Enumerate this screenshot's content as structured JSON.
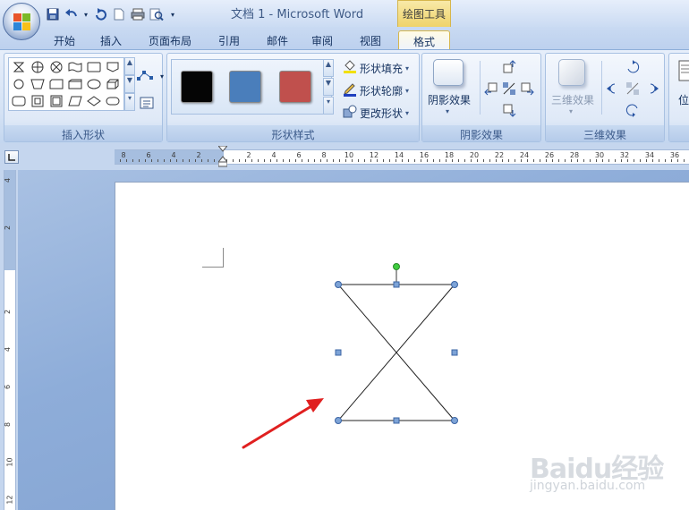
{
  "window": {
    "title": "文档 1 - Microsoft Word",
    "context_tab_group": "绘图工具"
  },
  "tabs": [
    {
      "label": "开始"
    },
    {
      "label": "插入"
    },
    {
      "label": "页面布局"
    },
    {
      "label": "引用"
    },
    {
      "label": "邮件"
    },
    {
      "label": "审阅"
    },
    {
      "label": "视图"
    },
    {
      "label": "格式",
      "active": true
    }
  ],
  "ribbon": {
    "insert_shapes": {
      "label": "插入形状",
      "icons": [
        "hourglass-icon",
        "cross-circle-icon",
        "x-circle-icon",
        "wave-icon",
        "rectangle-icon",
        "pentagon-icon",
        "circle-icon",
        "trapezoid-icon",
        "parallelogram-icon",
        "cylinder-icon",
        "ellipse-icon",
        "cube-icon",
        "rounded-rect-icon",
        "frame-icon",
        "can-icon",
        "parallelogram2-icon",
        "diamond-icon",
        "oval-icon"
      ]
    },
    "shape_styles": {
      "label": "形状样式",
      "swatches": [
        {
          "name": "black-style",
          "color": "#050505"
        },
        {
          "name": "blue-style",
          "color": "#4a7ebb"
        },
        {
          "name": "red-style",
          "color": "#c0504d"
        }
      ],
      "fill_label": "形状填充",
      "outline_label": "形状轮廓",
      "change_label": "更改形状"
    },
    "shadow_effects": {
      "label": "阴影效果",
      "button_label": "阴影效果"
    },
    "effects_3d": {
      "label": "三维效果",
      "button_label": "三维效果"
    },
    "arrange": {
      "button_label": "位"
    }
  },
  "ruler": {
    "horizontal_labels": [
      "8",
      "6",
      "4",
      "2",
      "2",
      "4",
      "6",
      "8",
      "10",
      "12",
      "14",
      "16",
      "18",
      "20",
      "22",
      "24",
      "26",
      "28",
      "30",
      "32",
      "34",
      "36"
    ],
    "vertical_labels": [
      "4",
      "2",
      "2",
      "4",
      "6",
      "8",
      "10",
      "12"
    ]
  },
  "watermark": {
    "main": "Baidu经验",
    "sub": "jingyan.baidu.com"
  },
  "colors": {
    "selection_handle": "#4a7fc1",
    "rotation_handle": "#3fcc3f",
    "annotation_arrow": "#e02020"
  }
}
